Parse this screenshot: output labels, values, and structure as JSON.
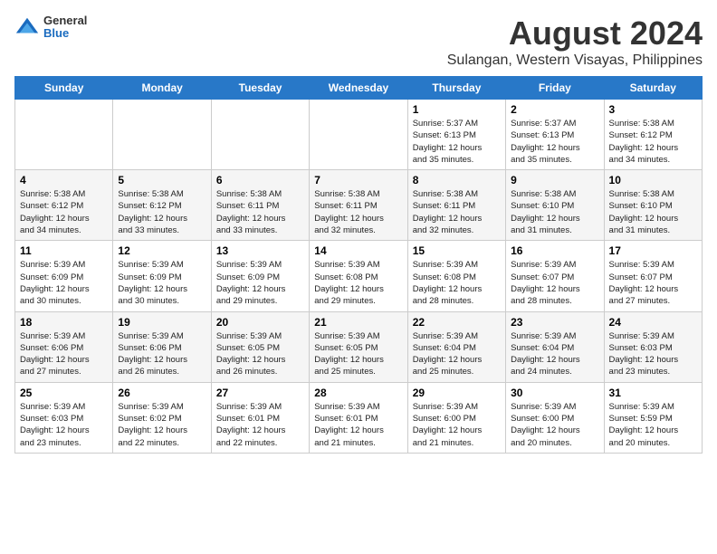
{
  "logo": {
    "general": "General",
    "blue": "Blue"
  },
  "title": "August 2024",
  "subtitle": "Sulangan, Western Visayas, Philippines",
  "weekdays": [
    "Sunday",
    "Monday",
    "Tuesday",
    "Wednesday",
    "Thursday",
    "Friday",
    "Saturday"
  ],
  "weeks": [
    [
      {
        "day": "",
        "info": ""
      },
      {
        "day": "",
        "info": ""
      },
      {
        "day": "",
        "info": ""
      },
      {
        "day": "",
        "info": ""
      },
      {
        "day": "1",
        "info": "Sunrise: 5:37 AM\nSunset: 6:13 PM\nDaylight: 12 hours\nand 35 minutes."
      },
      {
        "day": "2",
        "info": "Sunrise: 5:37 AM\nSunset: 6:13 PM\nDaylight: 12 hours\nand 35 minutes."
      },
      {
        "day": "3",
        "info": "Sunrise: 5:38 AM\nSunset: 6:12 PM\nDaylight: 12 hours\nand 34 minutes."
      }
    ],
    [
      {
        "day": "4",
        "info": "Sunrise: 5:38 AM\nSunset: 6:12 PM\nDaylight: 12 hours\nand 34 minutes."
      },
      {
        "day": "5",
        "info": "Sunrise: 5:38 AM\nSunset: 6:12 PM\nDaylight: 12 hours\nand 33 minutes."
      },
      {
        "day": "6",
        "info": "Sunrise: 5:38 AM\nSunset: 6:11 PM\nDaylight: 12 hours\nand 33 minutes."
      },
      {
        "day": "7",
        "info": "Sunrise: 5:38 AM\nSunset: 6:11 PM\nDaylight: 12 hours\nand 32 minutes."
      },
      {
        "day": "8",
        "info": "Sunrise: 5:38 AM\nSunset: 6:11 PM\nDaylight: 12 hours\nand 32 minutes."
      },
      {
        "day": "9",
        "info": "Sunrise: 5:38 AM\nSunset: 6:10 PM\nDaylight: 12 hours\nand 31 minutes."
      },
      {
        "day": "10",
        "info": "Sunrise: 5:38 AM\nSunset: 6:10 PM\nDaylight: 12 hours\nand 31 minutes."
      }
    ],
    [
      {
        "day": "11",
        "info": "Sunrise: 5:39 AM\nSunset: 6:09 PM\nDaylight: 12 hours\nand 30 minutes."
      },
      {
        "day": "12",
        "info": "Sunrise: 5:39 AM\nSunset: 6:09 PM\nDaylight: 12 hours\nand 30 minutes."
      },
      {
        "day": "13",
        "info": "Sunrise: 5:39 AM\nSunset: 6:09 PM\nDaylight: 12 hours\nand 29 minutes."
      },
      {
        "day": "14",
        "info": "Sunrise: 5:39 AM\nSunset: 6:08 PM\nDaylight: 12 hours\nand 29 minutes."
      },
      {
        "day": "15",
        "info": "Sunrise: 5:39 AM\nSunset: 6:08 PM\nDaylight: 12 hours\nand 28 minutes."
      },
      {
        "day": "16",
        "info": "Sunrise: 5:39 AM\nSunset: 6:07 PM\nDaylight: 12 hours\nand 28 minutes."
      },
      {
        "day": "17",
        "info": "Sunrise: 5:39 AM\nSunset: 6:07 PM\nDaylight: 12 hours\nand 27 minutes."
      }
    ],
    [
      {
        "day": "18",
        "info": "Sunrise: 5:39 AM\nSunset: 6:06 PM\nDaylight: 12 hours\nand 27 minutes."
      },
      {
        "day": "19",
        "info": "Sunrise: 5:39 AM\nSunset: 6:06 PM\nDaylight: 12 hours\nand 26 minutes."
      },
      {
        "day": "20",
        "info": "Sunrise: 5:39 AM\nSunset: 6:05 PM\nDaylight: 12 hours\nand 26 minutes."
      },
      {
        "day": "21",
        "info": "Sunrise: 5:39 AM\nSunset: 6:05 PM\nDaylight: 12 hours\nand 25 minutes."
      },
      {
        "day": "22",
        "info": "Sunrise: 5:39 AM\nSunset: 6:04 PM\nDaylight: 12 hours\nand 25 minutes."
      },
      {
        "day": "23",
        "info": "Sunrise: 5:39 AM\nSunset: 6:04 PM\nDaylight: 12 hours\nand 24 minutes."
      },
      {
        "day": "24",
        "info": "Sunrise: 5:39 AM\nSunset: 6:03 PM\nDaylight: 12 hours\nand 23 minutes."
      }
    ],
    [
      {
        "day": "25",
        "info": "Sunrise: 5:39 AM\nSunset: 6:03 PM\nDaylight: 12 hours\nand 23 minutes."
      },
      {
        "day": "26",
        "info": "Sunrise: 5:39 AM\nSunset: 6:02 PM\nDaylight: 12 hours\nand 22 minutes."
      },
      {
        "day": "27",
        "info": "Sunrise: 5:39 AM\nSunset: 6:01 PM\nDaylight: 12 hours\nand 22 minutes."
      },
      {
        "day": "28",
        "info": "Sunrise: 5:39 AM\nSunset: 6:01 PM\nDaylight: 12 hours\nand 21 minutes."
      },
      {
        "day": "29",
        "info": "Sunrise: 5:39 AM\nSunset: 6:00 PM\nDaylight: 12 hours\nand 21 minutes."
      },
      {
        "day": "30",
        "info": "Sunrise: 5:39 AM\nSunset: 6:00 PM\nDaylight: 12 hours\nand 20 minutes."
      },
      {
        "day": "31",
        "info": "Sunrise: 5:39 AM\nSunset: 5:59 PM\nDaylight: 12 hours\nand 20 minutes."
      }
    ]
  ]
}
